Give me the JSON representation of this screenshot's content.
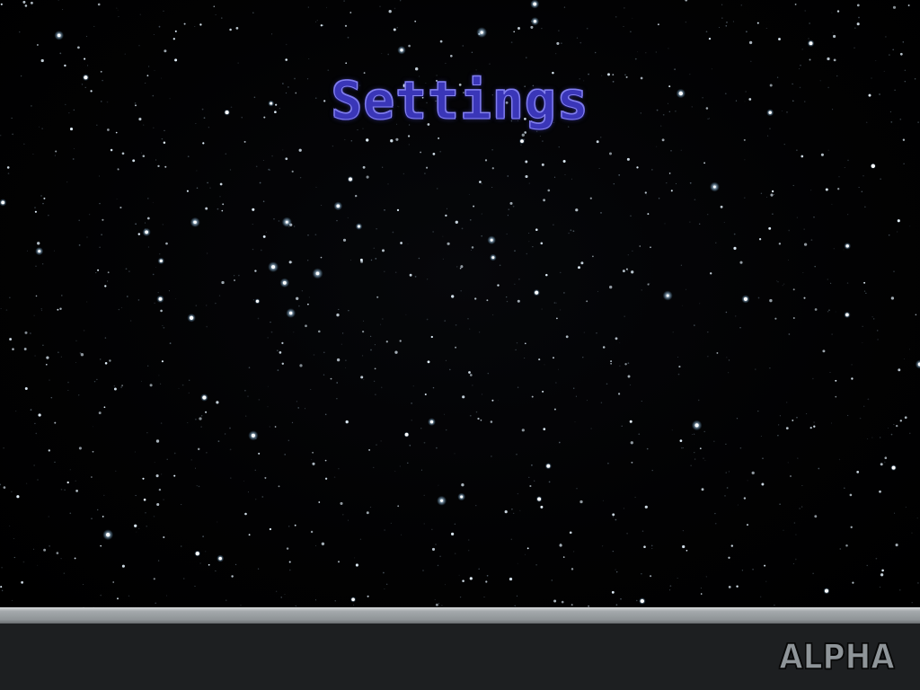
{
  "screen": {
    "title": "Settings",
    "build_label": "ALPHA"
  },
  "background": {
    "type": "starfield",
    "sky_color": "#000000",
    "star_color": "#e6f4ff"
  },
  "footer": {
    "rule_color": "#a4a9ac",
    "bar_color": "#1d1f21"
  }
}
